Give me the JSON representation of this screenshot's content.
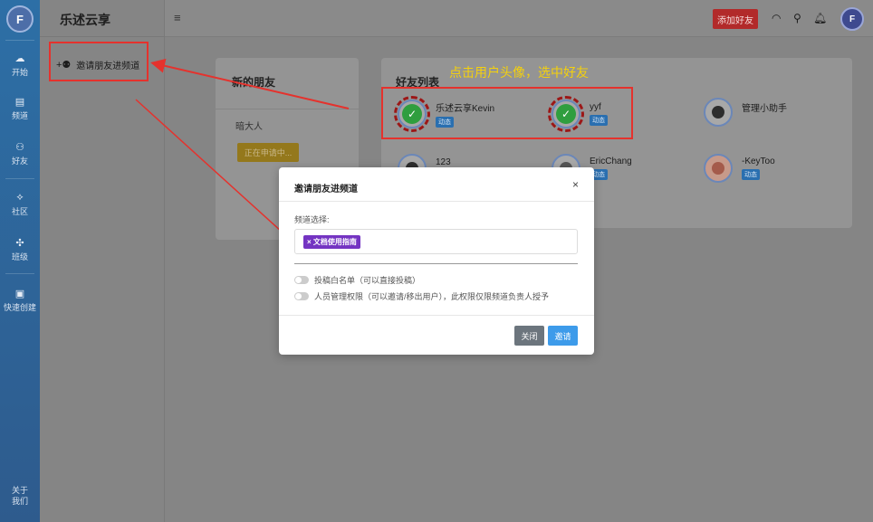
{
  "app": {
    "brand": "乐述云享",
    "logo_text": "F"
  },
  "rail": {
    "items": [
      {
        "icon": "cloud-icon",
        "glyph": "☁",
        "label": "开始"
      },
      {
        "icon": "channel-icon",
        "glyph": "▤",
        "label": "频道"
      },
      {
        "icon": "friends-icon",
        "glyph": "👥",
        "label": "好友"
      },
      {
        "icon": "community-icon",
        "glyph": "⟡",
        "label": "社区"
      },
      {
        "icon": "group-icon",
        "glyph": "✣",
        "label": "班级"
      },
      {
        "icon": "quick-create-icon",
        "glyph": "▣",
        "label": "快速创建"
      },
      {
        "icon": "about-icon",
        "glyph": "",
        "label": "关于我们"
      }
    ]
  },
  "menu": {
    "invite_item_label": "邀请朋友进频道"
  },
  "topbar": {
    "add_friend_label": "添加好友",
    "avatar_text": "F"
  },
  "new_friends": {
    "title": "新的朋友",
    "request_name": "暗大人",
    "request_button": "正在申请中..."
  },
  "friend_list": {
    "title": "好友列表",
    "friends": [
      {
        "name": "乐述云享Kevin",
        "badge": "动态",
        "selected": true
      },
      {
        "name": "yyf",
        "badge": "动态",
        "selected": true
      },
      {
        "name": "管理小助手",
        "badge": "",
        "selected": false
      },
      {
        "name": "123",
        "badge": "",
        "selected": false
      },
      {
        "name": "EricChang",
        "badge": "动态",
        "selected": false
      },
      {
        "name": "-KeyToo",
        "badge": "动态",
        "selected": false
      }
    ]
  },
  "annotation": {
    "text": "点击用户头像，选中好友"
  },
  "modal": {
    "title": "邀请朋友进频道",
    "close_symbol": "×",
    "channel_label": "频道选择:",
    "selected_channel": "× 文档使用指南",
    "option1": "投稿白名单（可以直接投稿）",
    "option2": "人员管理权限（可以邀请/移出用户），此权限仅限频道负责人授予",
    "close_button": "关闭",
    "invite_button": "邀请"
  },
  "colors": {
    "accent_red": "#e5322d",
    "annotation_yellow": "#f5d10c",
    "tag_purple": "#7434c2",
    "invite_blue": "#3d9bea"
  }
}
